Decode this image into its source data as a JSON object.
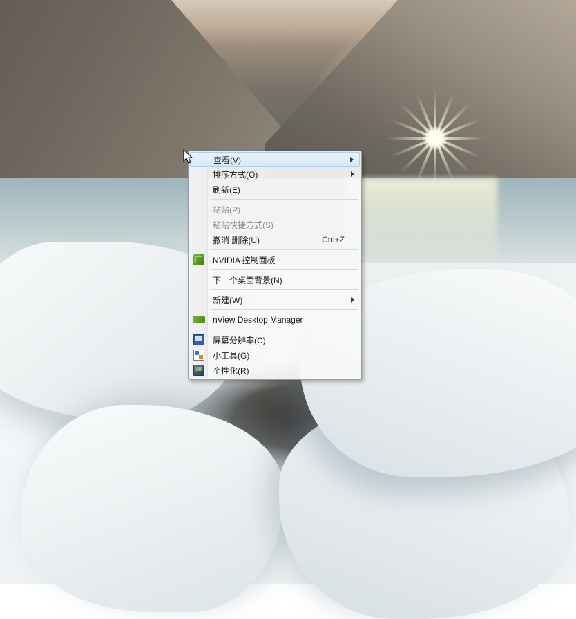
{
  "menu": {
    "items": [
      {
        "label": "查看(V)",
        "submenu": true,
        "disabled": false,
        "highlight": true,
        "icon": null,
        "shortcut": null
      },
      {
        "label": "排序方式(O)",
        "submenu": true,
        "disabled": false,
        "highlight": false,
        "icon": null,
        "shortcut": null
      },
      {
        "label": "刷新(E)",
        "submenu": false,
        "disabled": false,
        "highlight": false,
        "icon": null,
        "shortcut": null
      },
      {
        "separator": true
      },
      {
        "label": "粘贴(P)",
        "submenu": false,
        "disabled": true,
        "highlight": false,
        "icon": null,
        "shortcut": null
      },
      {
        "label": "粘贴快捷方式(S)",
        "submenu": false,
        "disabled": true,
        "highlight": false,
        "icon": null,
        "shortcut": null
      },
      {
        "label": "撤消 删除(U)",
        "submenu": false,
        "disabled": false,
        "highlight": false,
        "icon": null,
        "shortcut": "Ctrl+Z"
      },
      {
        "separator": true
      },
      {
        "label": "NVIDIA 控制面板",
        "submenu": false,
        "disabled": false,
        "highlight": false,
        "icon": "nvidia",
        "shortcut": null
      },
      {
        "separator": true
      },
      {
        "label": "下一个桌面背景(N)",
        "submenu": false,
        "disabled": false,
        "highlight": false,
        "icon": null,
        "shortcut": null
      },
      {
        "separator": true
      },
      {
        "label": "新建(W)",
        "submenu": true,
        "disabled": false,
        "highlight": false,
        "icon": null,
        "shortcut": null
      },
      {
        "separator": true
      },
      {
        "label": "nView Desktop Manager",
        "submenu": false,
        "disabled": false,
        "highlight": false,
        "icon": "nview",
        "shortcut": null
      },
      {
        "separator": true
      },
      {
        "label": "屏幕分辨率(C)",
        "submenu": false,
        "disabled": false,
        "highlight": false,
        "icon": "screen",
        "shortcut": null
      },
      {
        "label": "小工具(G)",
        "submenu": false,
        "disabled": false,
        "highlight": false,
        "icon": "gadget",
        "shortcut": null
      },
      {
        "label": "个性化(R)",
        "submenu": false,
        "disabled": false,
        "highlight": false,
        "icon": "personalize",
        "shortcut": null
      }
    ]
  }
}
